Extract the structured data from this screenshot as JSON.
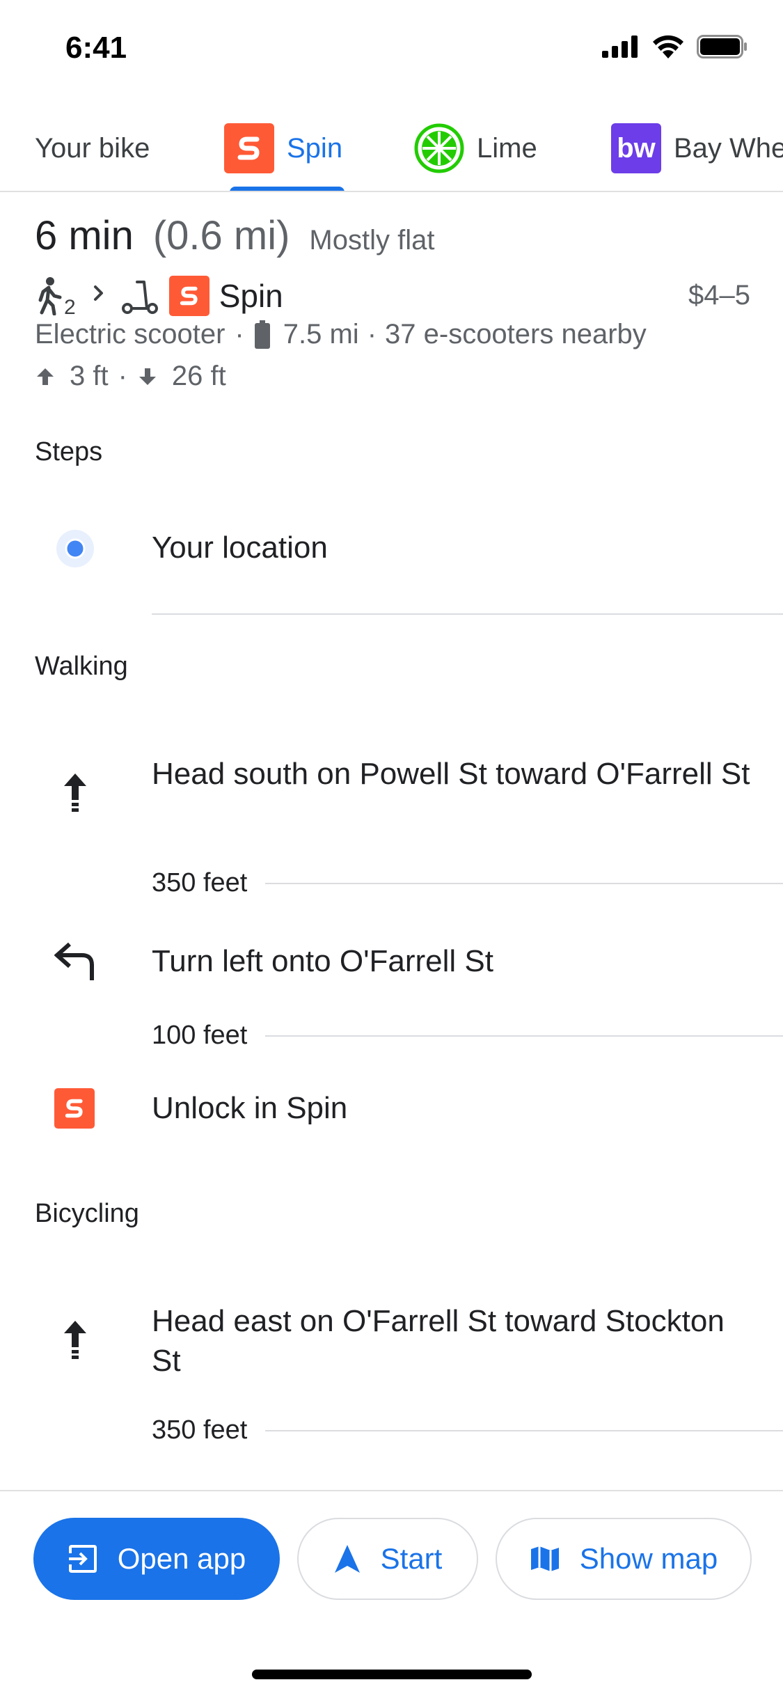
{
  "status_bar": {
    "time": "6:41"
  },
  "tabs": [
    {
      "label": "Your bike",
      "active": false
    },
    {
      "label": "Spin",
      "active": true,
      "logo": "spin-logo",
      "color": "#ff5a36"
    },
    {
      "label": "Lime",
      "active": false,
      "logo": "lime-logo",
      "color": "#22cc00"
    },
    {
      "label": "Bay Whe",
      "active": false,
      "logo": "bay-wheels-logo",
      "logo_text": "bw",
      "color": "#6c3de8"
    }
  ],
  "summary": {
    "duration": "6 min",
    "distance": "(0.6 mi)",
    "terrain": "Mostly flat",
    "walk_count": "2",
    "provider": "Spin",
    "price": "$4–5",
    "vehicle": "Electric scooter",
    "range": "7.5 mi",
    "nearby": "37 e-scooters nearby",
    "ascent": "3 ft",
    "descent": "26 ft"
  },
  "steps_title": "Steps",
  "origin": "Your location",
  "sections": {
    "walking": "Walking",
    "bicycling": "Bicycling"
  },
  "walking_steps": [
    {
      "icon": "straight-arrow-icon",
      "text": "Head south on Powell St toward O'Farrell St",
      "distance": "350 feet"
    },
    {
      "icon": "turn-left-icon",
      "text": "Turn left onto O'Farrell St",
      "distance": "100 feet"
    },
    {
      "icon": "spin-logo",
      "text": "Unlock in Spin"
    }
  ],
  "bicycling_steps": [
    {
      "icon": "straight-arrow-icon",
      "text": "Head east on O'Farrell St toward Stockton St",
      "distance": "350 feet"
    }
  ],
  "buttons": {
    "open_app": "Open app",
    "start": "Start",
    "show_map": "Show map"
  },
  "colors": {
    "accent": "#1a73e8",
    "spin": "#ff5a36",
    "lime": "#22cc00",
    "bay_wheels": "#6c3de8",
    "location_dot": "#4285f4"
  }
}
